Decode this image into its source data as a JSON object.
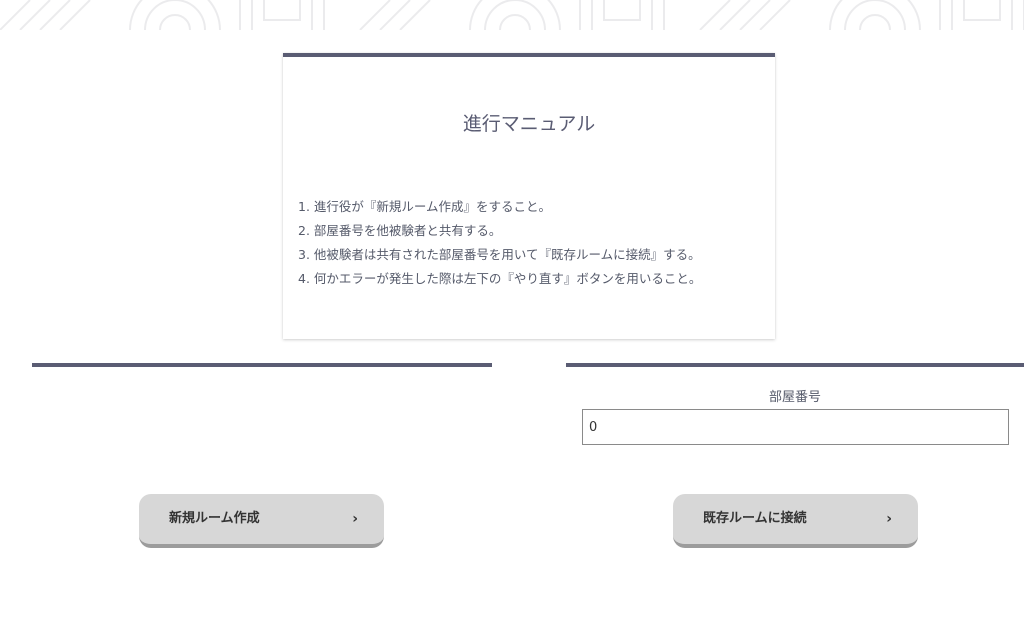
{
  "manual": {
    "title": "進行マニュアル",
    "steps": [
      "1. 進行役が『新規ルーム作成』をすること。",
      "2. 部屋番号を他被験者と共有する。",
      "3. 他被験者は共有された部屋番号を用いて『既存ルームに接続』する。",
      "4. 何かエラーが発生した際は左下の『やり直す』ボタンを用いること。"
    ]
  },
  "join": {
    "room_label": "部屋番号",
    "room_value": "0"
  },
  "buttons": {
    "create_label": "新規ルーム作成",
    "connect_label": "既存ルームに接続",
    "arrow": "›"
  },
  "colors": {
    "accent_bar": "#5a5c73",
    "button_bg": "#d7d7d7",
    "text": "#555a6a"
  }
}
